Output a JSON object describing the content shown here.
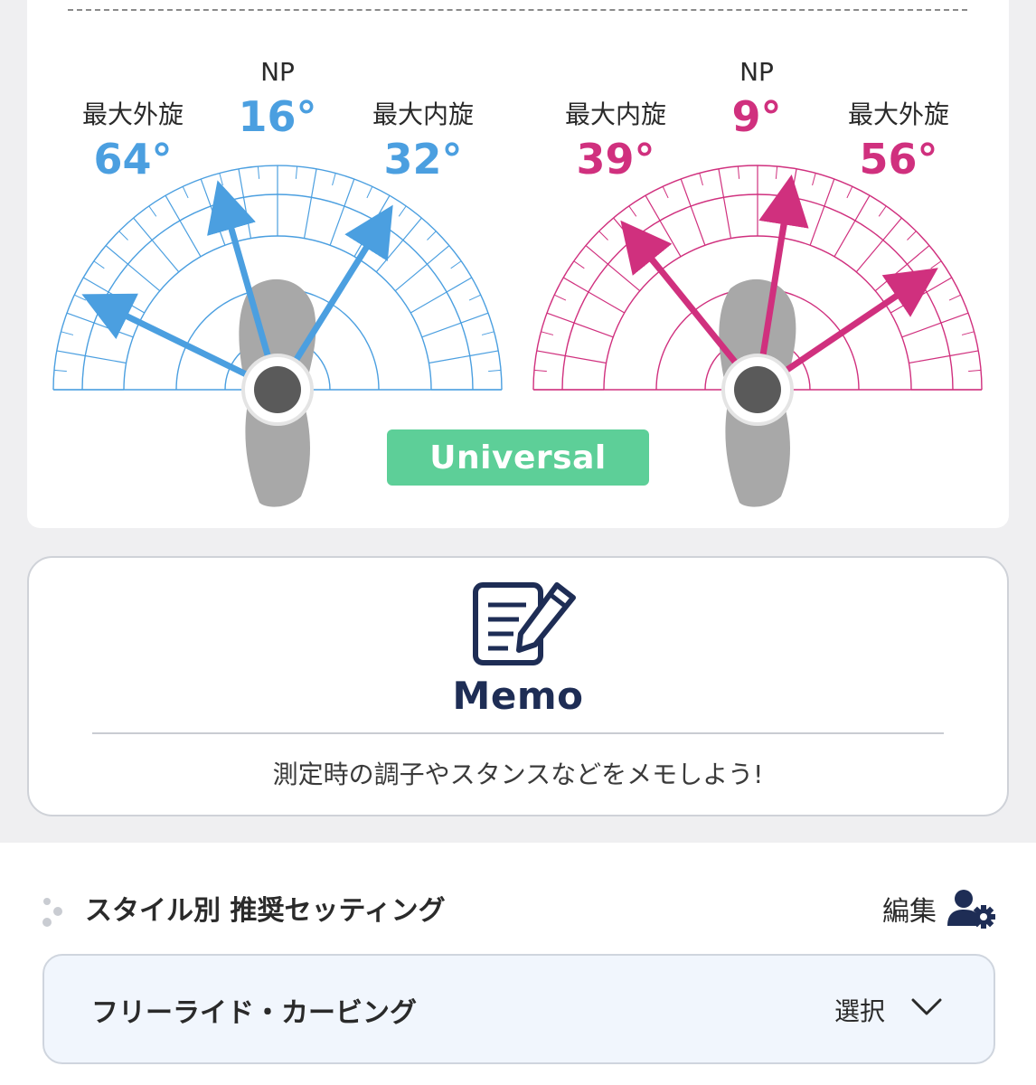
{
  "colors": {
    "left_accent": "#4b9fe0",
    "right_accent": "#d0307e",
    "badge_green": "#5dcf98",
    "navy": "#1e2d55",
    "foot_gray": "#a8a8a8"
  },
  "left_gauge": {
    "external": {
      "label": "最大外旋",
      "value": "64°",
      "angle": 64,
      "side": "left"
    },
    "np": {
      "label": "NP",
      "value": "16°",
      "angle": 16,
      "side": "left"
    },
    "internal": {
      "label": "最大内旋",
      "value": "32°",
      "angle": 32,
      "side": "right"
    }
  },
  "right_gauge": {
    "internal": {
      "label": "最大内旋",
      "value": "39°",
      "angle": 39,
      "side": "left"
    },
    "np": {
      "label": "NP",
      "value": "9°",
      "angle": 9,
      "side": "right"
    },
    "external": {
      "label": "最大外旋",
      "value": "56°",
      "angle": 56,
      "side": "right"
    }
  },
  "stance_badge": "Universal",
  "memo": {
    "title": "Memo",
    "icon": "memo-edit-icon",
    "hint": "測定時の調子やスタンスなどをメモしよう!"
  },
  "section": {
    "title": "スタイル別 推奨セッティング",
    "edit_label": "編集",
    "edit_icon": "user-gear-icon"
  },
  "style_select": {
    "value": "フリーライド・カービング",
    "action_label": "選択",
    "icon": "chevron-down-icon"
  }
}
